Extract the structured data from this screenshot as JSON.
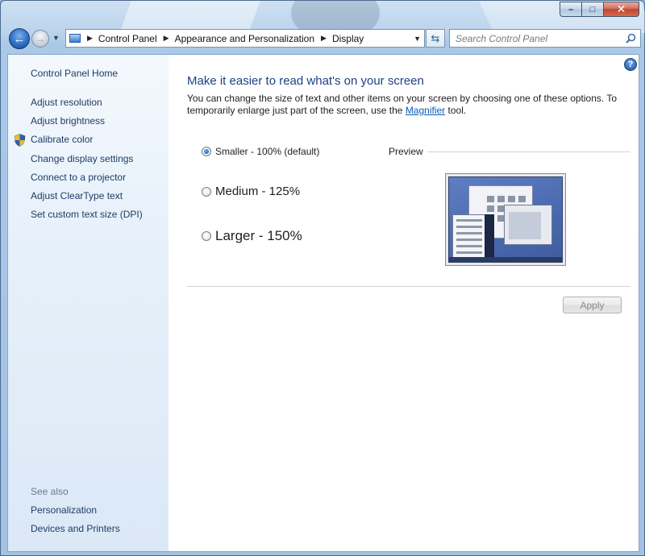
{
  "window": {
    "caption": {
      "minimize": "–",
      "maximize": "□",
      "close": "✕"
    }
  },
  "nav": {
    "breadcrumbs": [
      "Control Panel",
      "Appearance and Personalization",
      "Display"
    ],
    "search_placeholder": "Search Control Panel"
  },
  "sidebar": {
    "home": "Control Panel Home",
    "items": [
      "Adjust resolution",
      "Adjust brightness",
      "Calibrate color",
      "Change display settings",
      "Connect to a projector",
      "Adjust ClearType text",
      "Set custom text size (DPI)"
    ],
    "see_also_label": "See also",
    "see_also": [
      "Personalization",
      "Devices and Printers"
    ]
  },
  "main": {
    "heading": "Make it easier to read what's on your screen",
    "description_before": "You can change the size of text and other items on your screen by choosing one of these options. To temporarily enlarge just part of the screen, use the ",
    "description_link": "Magnifier",
    "description_after": " tool.",
    "options": [
      {
        "label": "Smaller - 100% (default)",
        "selected": true
      },
      {
        "label": "Medium - 125%",
        "selected": false
      },
      {
        "label": "Larger - 150%",
        "selected": false
      }
    ],
    "preview_label": "Preview",
    "apply_label": "Apply",
    "help_label": "?"
  },
  "colors": {
    "link": "#1e3c66",
    "heading": "#1e3f86",
    "hyperlink": "#0a5bb5",
    "disabled_text": "#8b8b8b"
  }
}
